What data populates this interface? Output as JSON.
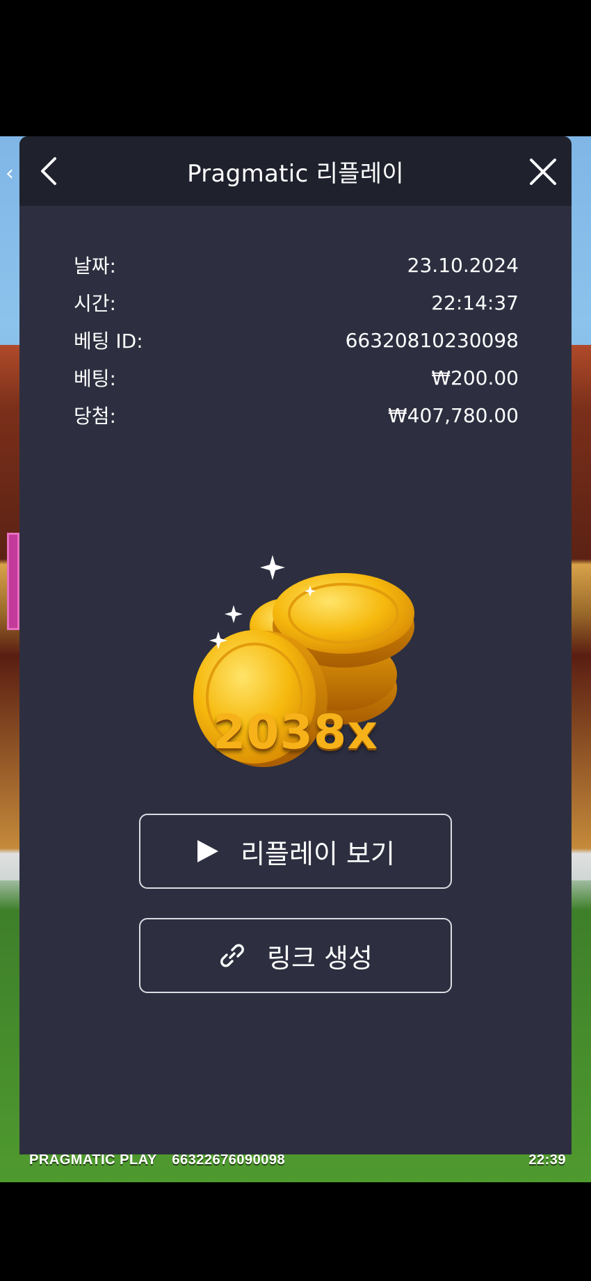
{
  "modal": {
    "title": "Pragmatic 리플레이",
    "back_icon": "chevron-left-icon",
    "close_icon": "close-icon"
  },
  "details": [
    {
      "label": "날짜:",
      "value": "23.10.2024"
    },
    {
      "label": "시간:",
      "value": "22:14:37"
    },
    {
      "label": "베팅 ID:",
      "value": "66320810230098"
    },
    {
      "label": "베팅:",
      "value": "₩200.00"
    },
    {
      "label": "당첨:",
      "value": "₩407,780.00"
    }
  ],
  "win": {
    "multiplier": "2038x",
    "image": "gold-coins-icon"
  },
  "buttons": {
    "replay_label": "리플레이 보기",
    "replay_icon": "play-icon",
    "link_label": "링크 생성",
    "link_icon": "link-icon"
  },
  "game_footer": {
    "brand": "PRAGMATIC PLAY",
    "round_id": "66322676090098",
    "clock": "22:39"
  },
  "colors": {
    "modal_bg": "#2d2f40",
    "header_bg": "#1f212d",
    "multiplier": "#f7b21a",
    "text": "#ffffff"
  }
}
